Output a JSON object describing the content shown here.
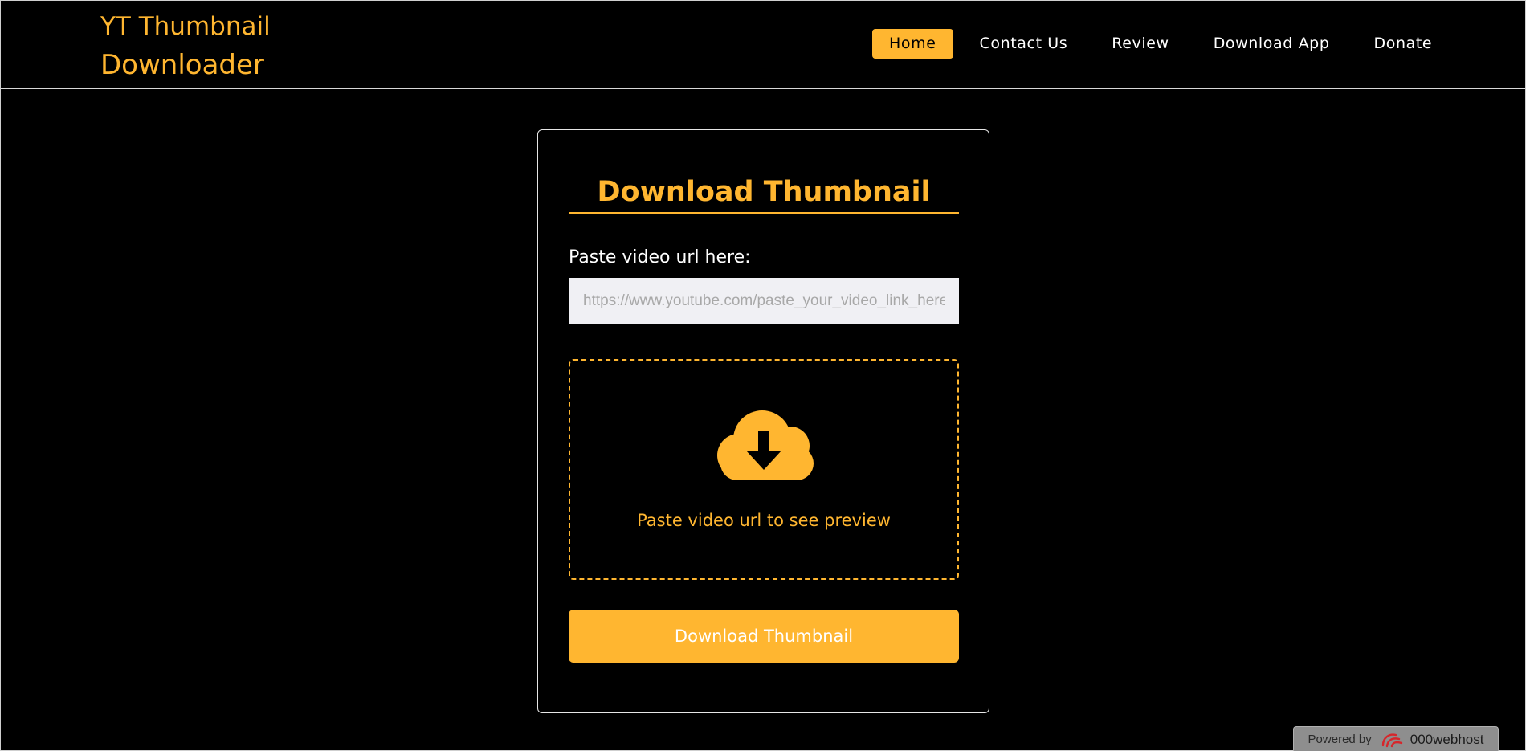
{
  "header": {
    "logo_line1": "YT Thumbnail",
    "logo_line2": "Downloader",
    "nav": [
      {
        "label": "Home",
        "active": true
      },
      {
        "label": "Contact Us"
      },
      {
        "label": "Review"
      },
      {
        "label": "Download App"
      },
      {
        "label": "Donate"
      }
    ]
  },
  "card": {
    "title": "Download Thumbnail",
    "url_label": "Paste video url here:",
    "url_input": {
      "value": "",
      "placeholder": "https://www.youtube.com/paste_your_video_link_here"
    },
    "preview_icon": "cloud-download-icon",
    "preview_text": "Paste video url to see preview",
    "button_label": "Download Thumbnail"
  },
  "footer": {
    "powered_label": "Powered by",
    "brand": "000webhost",
    "brand_icon": "000webhost-logo-icon"
  },
  "colors": {
    "accent": "#ffb630",
    "background": "#000000",
    "text": "#ffffff"
  }
}
